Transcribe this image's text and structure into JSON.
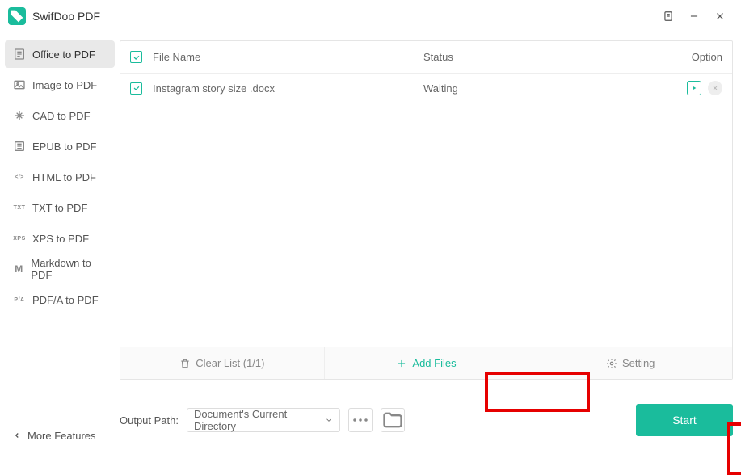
{
  "app": {
    "title": "SwifDoo PDF"
  },
  "sidebar": {
    "items": [
      {
        "label": "Office to PDF",
        "icon": "office"
      },
      {
        "label": "Image to PDF",
        "icon": "image"
      },
      {
        "label": "CAD to PDF",
        "icon": "cad"
      },
      {
        "label": "EPUB to PDF",
        "icon": "epub"
      },
      {
        "label": "HTML to PDF",
        "icon": "html"
      },
      {
        "label": "TXT to PDF",
        "icon": "TXT"
      },
      {
        "label": "XPS to PDF",
        "icon": "XPS"
      },
      {
        "label": "Markdown to PDF",
        "icon": "M"
      },
      {
        "label": "PDF/A to PDF",
        "icon": "P/A"
      }
    ],
    "more_label": "More Features"
  },
  "table": {
    "headers": {
      "name": "File Name",
      "status": "Status",
      "option": "Option"
    },
    "rows": [
      {
        "name": "Instagram story size .docx",
        "status": "Waiting"
      }
    ]
  },
  "toolbar": {
    "clear_label": "Clear List (1/1)",
    "add_label": "Add Files",
    "setting_label": "Setting"
  },
  "bottom": {
    "output_label": "Output Path:",
    "select_value": "Document's Current Directory",
    "start_label": "Start"
  }
}
